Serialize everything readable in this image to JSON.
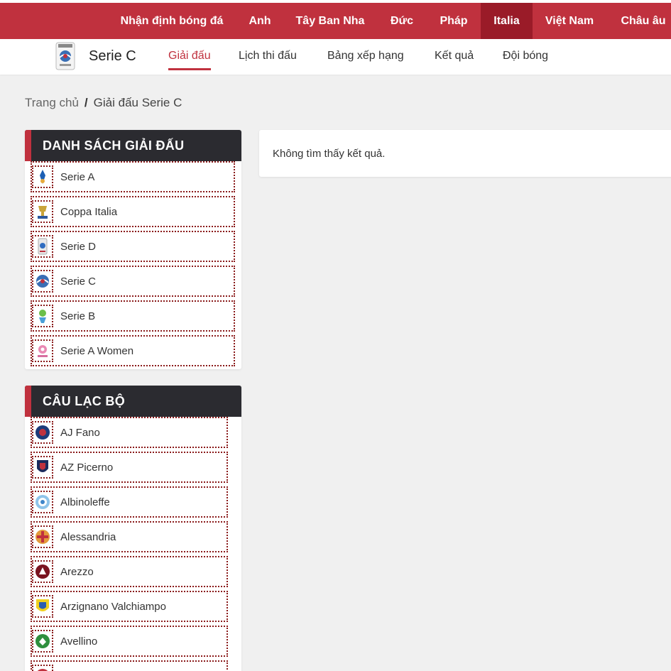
{
  "top_nav": [
    {
      "label": "Nhận định bóng đá",
      "active": false
    },
    {
      "label": "Anh",
      "active": false
    },
    {
      "label": "Tây Ban Nha",
      "active": false
    },
    {
      "label": "Đức",
      "active": false
    },
    {
      "label": "Pháp",
      "active": false
    },
    {
      "label": "Italia",
      "active": true
    },
    {
      "label": "Việt Nam",
      "active": false
    },
    {
      "label": "Châu âu",
      "active": false
    }
  ],
  "league": {
    "title": "Serie C",
    "logo_icon": "serie-c-logo",
    "tabs": [
      {
        "label": "Giải đấu",
        "active": true
      },
      {
        "label": "Lịch thi đấu",
        "active": false
      },
      {
        "label": "Bảng xếp hạng",
        "active": false
      },
      {
        "label": "Kết quả",
        "active": false
      },
      {
        "label": "Đội bóng",
        "active": false
      }
    ]
  },
  "breadcrumb": {
    "home": "Trang chủ",
    "separator": "/",
    "current": "Giải đấu Serie C"
  },
  "tournaments": {
    "title": "DANH SÁCH GIẢI ĐẤU",
    "items": [
      {
        "label": "Serie A",
        "icon": "serie-a-icon"
      },
      {
        "label": "Coppa Italia",
        "icon": "coppa-italia-icon"
      },
      {
        "label": "Serie D",
        "icon": "serie-d-icon"
      },
      {
        "label": "Serie C",
        "icon": "serie-c-icon"
      },
      {
        "label": "Serie B",
        "icon": "serie-b-icon"
      },
      {
        "label": "Serie A Women",
        "icon": "serie-a-women-icon"
      }
    ]
  },
  "clubs": {
    "title": "CÂU LẠC BỘ",
    "items": [
      {
        "label": "AJ Fano",
        "icon": "aj-fano-crest-icon"
      },
      {
        "label": "AZ Picerno",
        "icon": "az-picerno-crest-icon"
      },
      {
        "label": "Albinoleffe",
        "icon": "albinoleffe-crest-icon"
      },
      {
        "label": "Alessandria",
        "icon": "alessandria-crest-icon"
      },
      {
        "label": "Arezzo",
        "icon": "arezzo-crest-icon"
      },
      {
        "label": "Arzignano Valchiampo",
        "icon": "arzignano-crest-icon"
      },
      {
        "label": "Avellino",
        "icon": "avellino-crest-icon"
      },
      {
        "label": "",
        "icon": "club-crest-icon"
      }
    ]
  },
  "main": {
    "empty_message": "Không tìm thấy kết quả."
  },
  "colors": {
    "brand_red": "#c0313e",
    "active_red": "#9a1b28",
    "panel_dark": "#2b2b30"
  }
}
